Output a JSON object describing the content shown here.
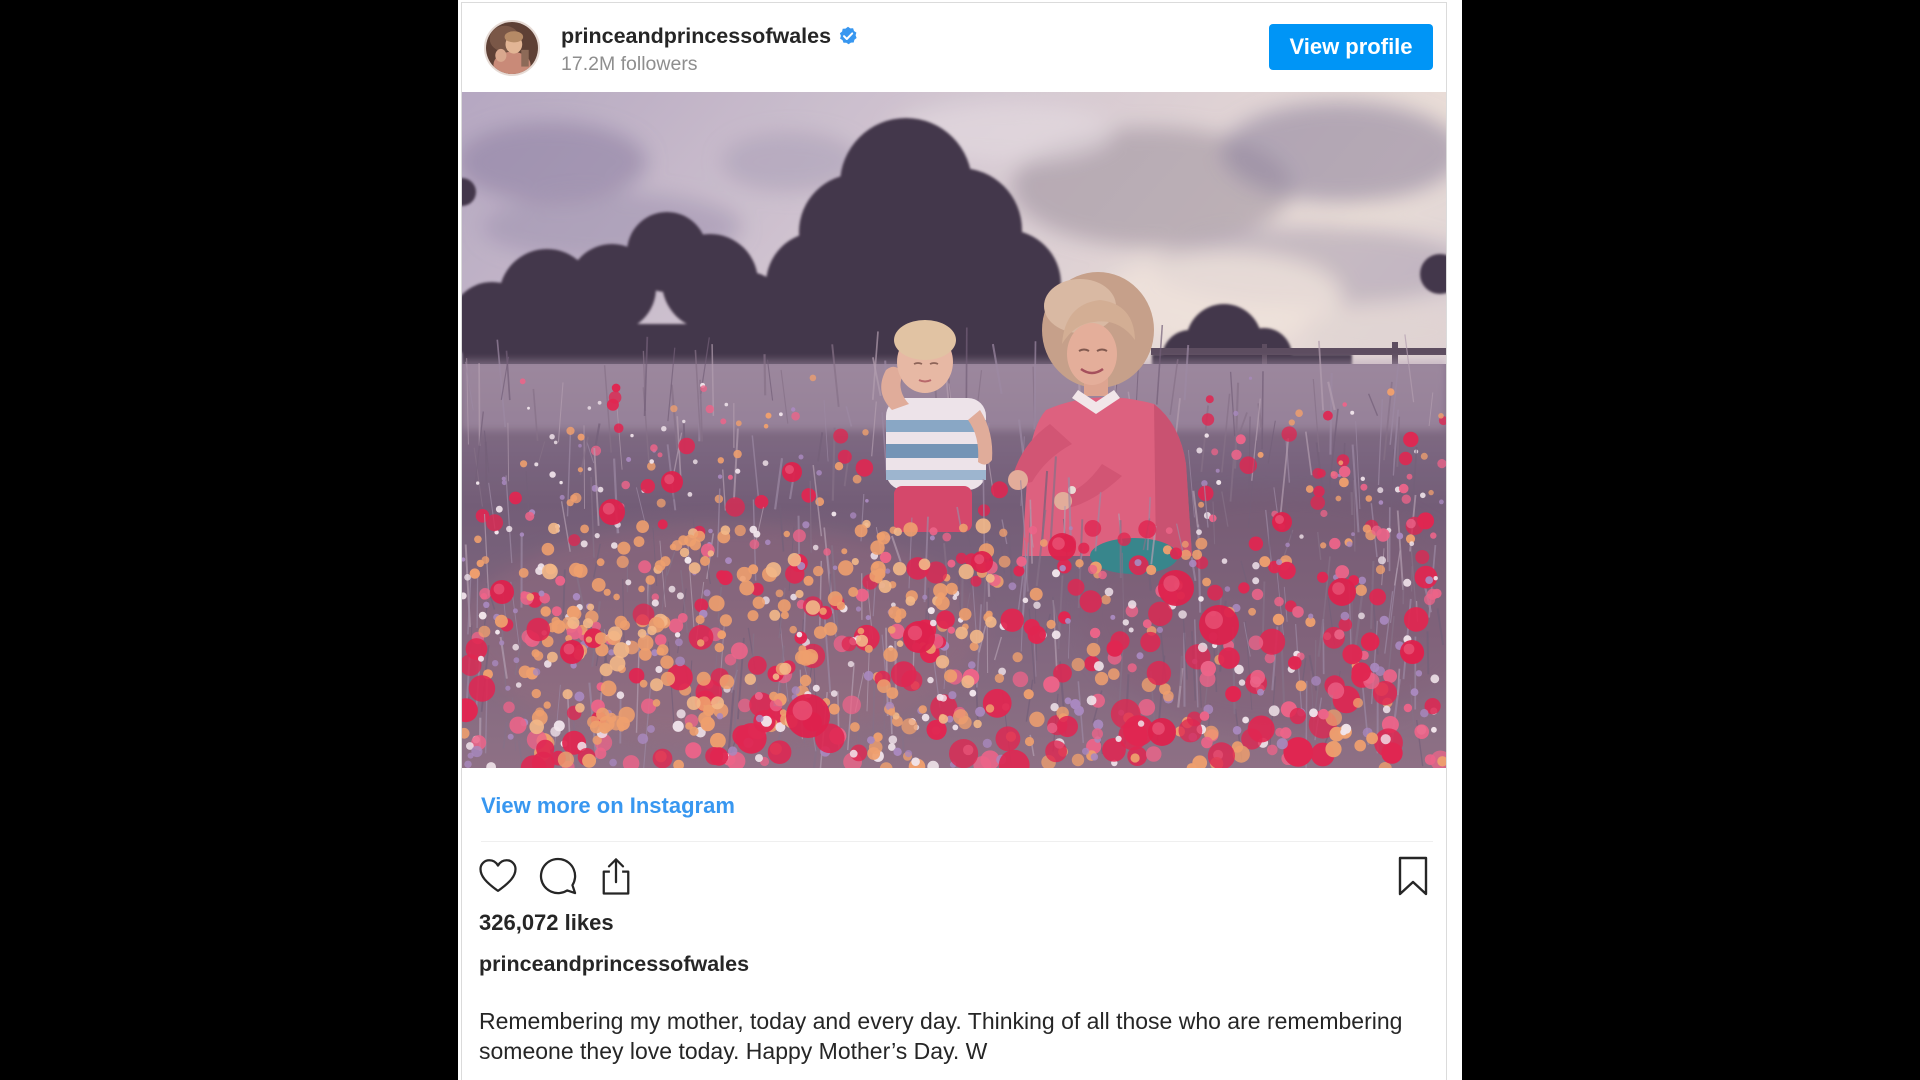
{
  "header": {
    "username": "princeandprincessofwales",
    "verified": true,
    "followers": "17.2M followers",
    "view_profile_label": "View profile"
  },
  "post": {
    "view_more_label": "View more on Instagram",
    "likes": "326,072 likes",
    "caption_username": "princeandprincessofwales",
    "caption_text": "Remembering my mother, today and every day. Thinking of all those who are remembering someone they love today. Happy Mother’s Day. W"
  },
  "icons": {
    "avatar": "avatar",
    "verified": "verified-badge-icon",
    "like": "heart-icon",
    "comment": "comment-icon",
    "share": "share-icon",
    "save": "bookmark-icon"
  },
  "colors": {
    "page_background": "#000000",
    "card_background": "#ffffff",
    "button": "#0095f6",
    "link": "#3897f0",
    "text": "#262626",
    "muted_text": "#8e8e8e",
    "verified_badge": "#3897f0"
  }
}
